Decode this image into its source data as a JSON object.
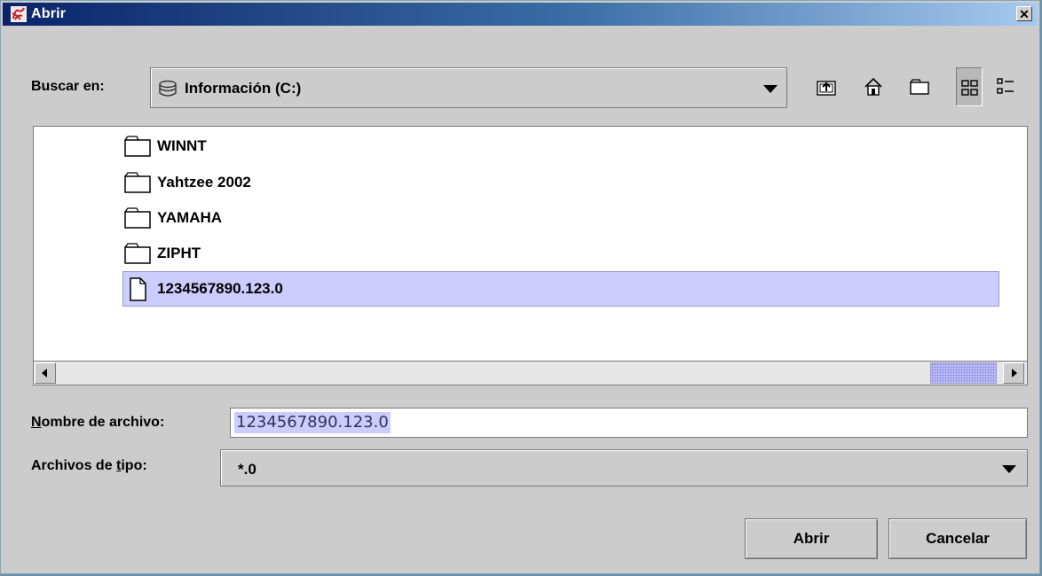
{
  "window": {
    "title": "Abrir",
    "close_glyph": "✕"
  },
  "lookin": {
    "label": "Buscar en:",
    "value": "Información (C:)",
    "icon": "drive-icon"
  },
  "toolbar": [
    {
      "name": "up-folder-button",
      "icon": "up-folder-icon"
    },
    {
      "name": "home-button",
      "icon": "home-icon"
    },
    {
      "name": "new-folder-button",
      "icon": "new-folder-icon"
    },
    {
      "name": "list-view-button",
      "icon": "list-view-icon",
      "pressed": true
    },
    {
      "name": "details-view-button",
      "icon": "details-view-icon"
    }
  ],
  "files": [
    {
      "name": "WINNT",
      "type": "folder"
    },
    {
      "name": "Yahtzee 2002",
      "type": "folder"
    },
    {
      "name": "YAMAHA",
      "type": "folder"
    },
    {
      "name": "ZIPHT",
      "type": "folder"
    },
    {
      "name": "1234567890.123.0",
      "type": "file",
      "selected": true
    }
  ],
  "filename": {
    "label_mnemonic": "N",
    "label_rest": "ombre de archivo:",
    "value": "1234567890.123.0"
  },
  "filetype": {
    "label_pre": "Archivos de ",
    "label_mnemonic": "t",
    "label_post": "ipo:",
    "value": "*.0"
  },
  "buttons": {
    "open": "Abrir",
    "cancel": "Cancelar"
  },
  "colors": {
    "selection": "#ccccff",
    "title_gradient_start": "#0a246a",
    "title_gradient_end": "#a6caf0"
  }
}
